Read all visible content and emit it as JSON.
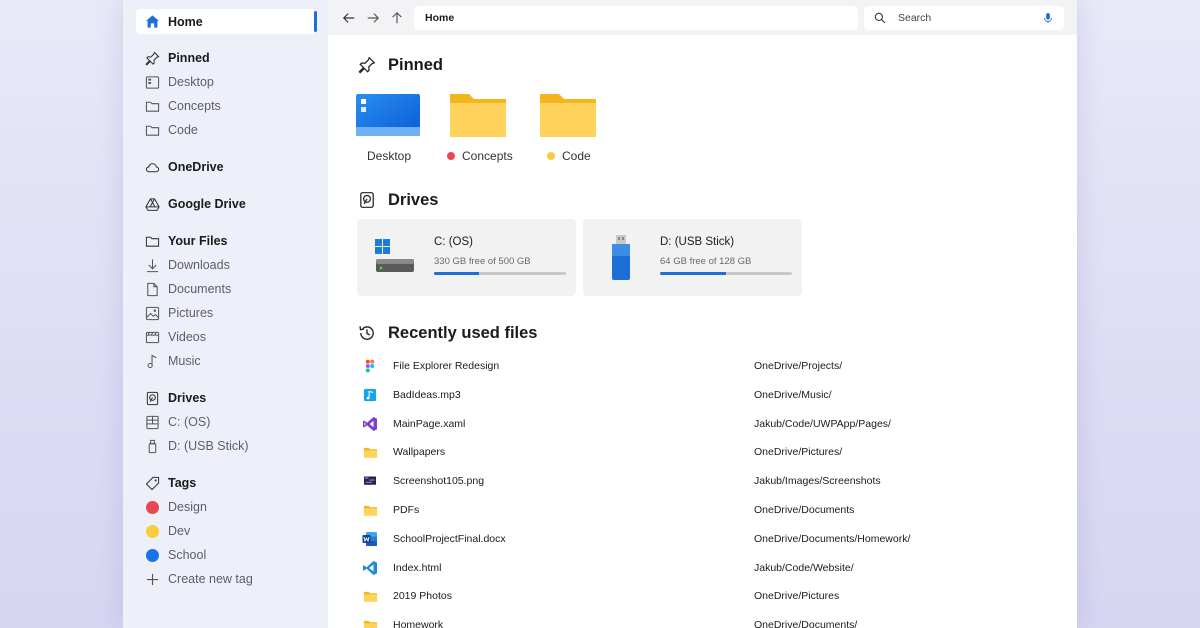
{
  "sidebar": {
    "home": "Home",
    "pinned": "Pinned",
    "pinned_items": [
      "Desktop",
      "Concepts",
      "Code"
    ],
    "onedrive": "OneDrive",
    "google_drive": "Google Drive",
    "your_files": "Your Files",
    "file_items": [
      "Downloads",
      "Documents",
      "Pictures",
      "Videos",
      "Music"
    ],
    "drives": "Drives",
    "drive_items": [
      "C: (OS)",
      "D: (USB Stick)"
    ],
    "tags": "Tags",
    "tag_items": [
      {
        "label": "Design",
        "color": "#e8474f"
      },
      {
        "label": "Dev",
        "color": "#f6cd3c"
      },
      {
        "label": "School",
        "color": "#1a73e8"
      }
    ],
    "create_tag": "Create new tag"
  },
  "toolbar": {
    "address": "Home",
    "search_placeholder": "Search"
  },
  "main": {
    "pinned_title": "Pinned",
    "pinned": [
      {
        "label": "Desktop",
        "tag_color": ""
      },
      {
        "label": "Concepts",
        "tag_color": "#e8474f"
      },
      {
        "label": "Code",
        "tag_color": "#f6cd3c"
      }
    ],
    "drives_title": "Drives",
    "drives": [
      {
        "name": "C: (OS)",
        "free": "330 GB free of 500 GB",
        "used_fraction": 0.34
      },
      {
        "name": "D: (USB Stick)",
        "free": "64 GB free of 128 GB",
        "used_fraction": 0.5
      }
    ],
    "recent_title": "Recently used files",
    "recent": [
      {
        "name": "File Explorer Redesign",
        "path": "OneDrive/Projects/",
        "icon": "figma-icon"
      },
      {
        "name": "BadIdeas.mp3",
        "path": "OneDrive/Music/",
        "icon": "music-file-icon"
      },
      {
        "name": "MainPage.xaml",
        "path": "Jakub/Code/UWPApp/Pages/",
        "icon": "visual-studio-icon"
      },
      {
        "name": "Wallpapers",
        "path": "OneDrive/Pictures/",
        "icon": "folder-icon"
      },
      {
        "name": "Screenshot105.png",
        "path": "Jakub/Images/Screenshots",
        "icon": "image-file-icon"
      },
      {
        "name": "PDFs",
        "path": "OneDrive/Documents",
        "icon": "folder-icon"
      },
      {
        "name": "SchoolProjectFinal.docx",
        "path": "OneDrive/Documents/Homework/",
        "icon": "word-icon"
      },
      {
        "name": "Index.html",
        "path": "Jakub/Code/Website/",
        "icon": "vscode-icon"
      },
      {
        "name": "2019 Photos",
        "path": "OneDrive/Pictures",
        "icon": "folder-icon"
      },
      {
        "name": "Homework",
        "path": "OneDrive/Documents/",
        "icon": "folder-icon"
      }
    ]
  }
}
